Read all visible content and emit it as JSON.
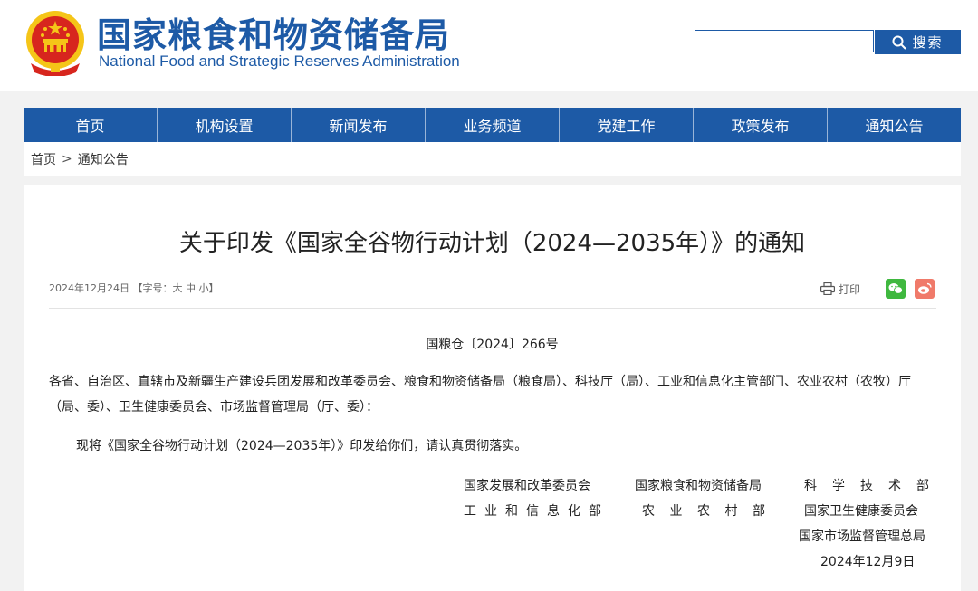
{
  "header": {
    "title_cn": "国家粮食和物资储备局",
    "title_en": "National Food and Strategic Reserves Administration",
    "search_placeholder": "",
    "search_label": "搜索"
  },
  "nav": {
    "items": [
      "首页",
      "机构设置",
      "新闻发布",
      "业务频道",
      "党建工作",
      "政策发布",
      "通知公告"
    ]
  },
  "breadcrumb": {
    "home": "首页",
    "separator": ">",
    "current": "通知公告"
  },
  "article": {
    "title": "关于印发《国家全谷物行动计划（2024—2035年）》的通知",
    "date": "2024年12月24日",
    "font_size_label": "【字号：",
    "font_large": "大",
    "font_medium": "中",
    "font_small": "小",
    "font_size_end": "】",
    "print_label": "打印",
    "doc_number": "国粮仓〔2024〕266号",
    "recipients": "各省、自治区、直辖市及新疆生产建设兵团发展和改革委员会、粮食和物资储备局（粮食局）、科技厅（局）、工业和信息化主管部门、农业农村（农牧）厅（局、委）、卫生健康委员会、市场监督管理局（厅、委）：",
    "body": "现将《国家全谷物行动计划（2024—2035年）》印发给你们，请认真贯彻落实。",
    "signatories": {
      "col1": [
        "国家发展和改革委员会",
        "工业和信息化部"
      ],
      "col2": [
        "国家粮食和物资储备局",
        "农业农村部"
      ],
      "col3": [
        "科学技术部",
        "国家卫生健康委员会",
        "国家市场监督管理总局"
      ]
    },
    "sign_date": "2024年12月9日"
  },
  "colors": {
    "brand_blue": "#1d5aa6",
    "emblem_red": "#d7261e",
    "emblem_gold": "#f5c518",
    "wechat": "#3fb83f",
    "weibo": "#f07a6a"
  }
}
